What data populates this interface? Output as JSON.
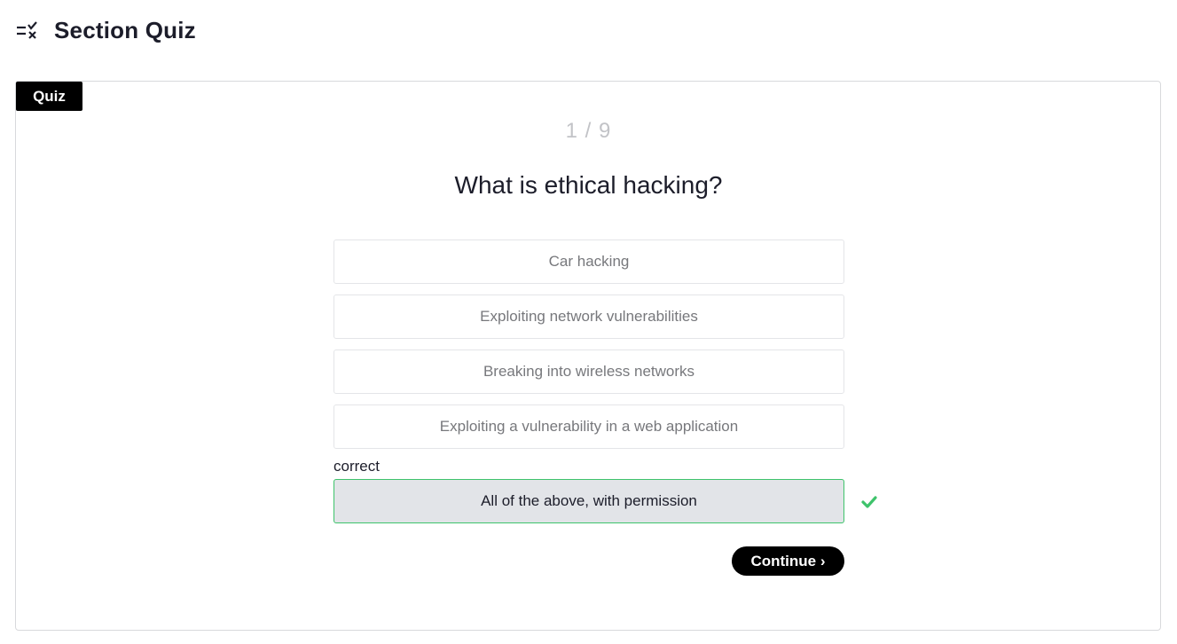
{
  "header": {
    "title": "Section Quiz",
    "icon": "quiz-list-icon"
  },
  "quiz": {
    "tag": "Quiz",
    "counter": "1 / 9",
    "question": "What is ethical hacking?",
    "options": [
      "Car hacking",
      "Exploiting network vulnerabilities",
      "Breaking into wireless networks",
      "Exploiting a vulnerability in a web application"
    ],
    "result_label": "correct",
    "selected_option": "All of the above, with permission",
    "result_icon": "checkmark-icon",
    "continue_label": "Continue ›"
  },
  "colors": {
    "accent_green": "#3ec36b",
    "button_black": "#000000",
    "selected_bg": "#e2e4e8"
  }
}
